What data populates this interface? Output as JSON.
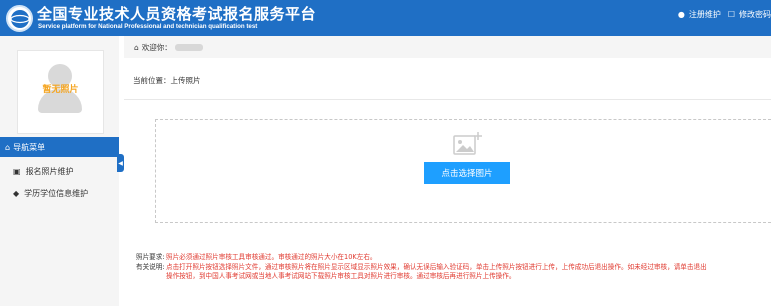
{
  "header": {
    "title_cn": "全国专业技术人员资格考试报名服务平台",
    "title_en": "Service platform for National Professional and technician qualification test",
    "links": [
      {
        "icon": "info-circle-icon",
        "label": "注册维护"
      },
      {
        "icon": "edit-square-icon",
        "label": "修改密码"
      }
    ]
  },
  "sidebar": {
    "avatar_placeholder": "暂无照片",
    "nav_header": "导航菜单",
    "items": [
      {
        "icon": "photo-icon",
        "label": "报名照片维护"
      },
      {
        "icon": "graduation-cap-icon",
        "label": "学历学位信息维护"
      }
    ]
  },
  "main": {
    "welcome_label": "欢迎你：",
    "breadcrumb": "当前位置：上传照片",
    "upload_button": "点击选择图片",
    "notes": {
      "req_label": "照片要求:",
      "req_text": "照片必须通过照片审核工具审核通过。",
      "req_warn": "审核通过的照片大小在10K左右。",
      "desc_label": "有关说明:",
      "desc_line1": "点击打开照片按钮选择照片文件，通过审核照片将在照片显示区域显示照片效果，确认无误后输入验证码，单击上传照片按钮进行上传，上传成功后退出操作。如未经过审核，请单击退出",
      "desc_line2_a": "操作按钮，到中国人事考试网或当地人事考试网站下载",
      "desc_line2_link": "照片审核工具",
      "desc_line2_b": "对照片进行审核。通过审核后再进行照片上传操作。"
    }
  },
  "colors": {
    "brand_blue": "#1f6fc5",
    "button_blue": "#1e9fff",
    "warning_red": "#e0392f",
    "placeholder_orange": "#f5a623"
  }
}
